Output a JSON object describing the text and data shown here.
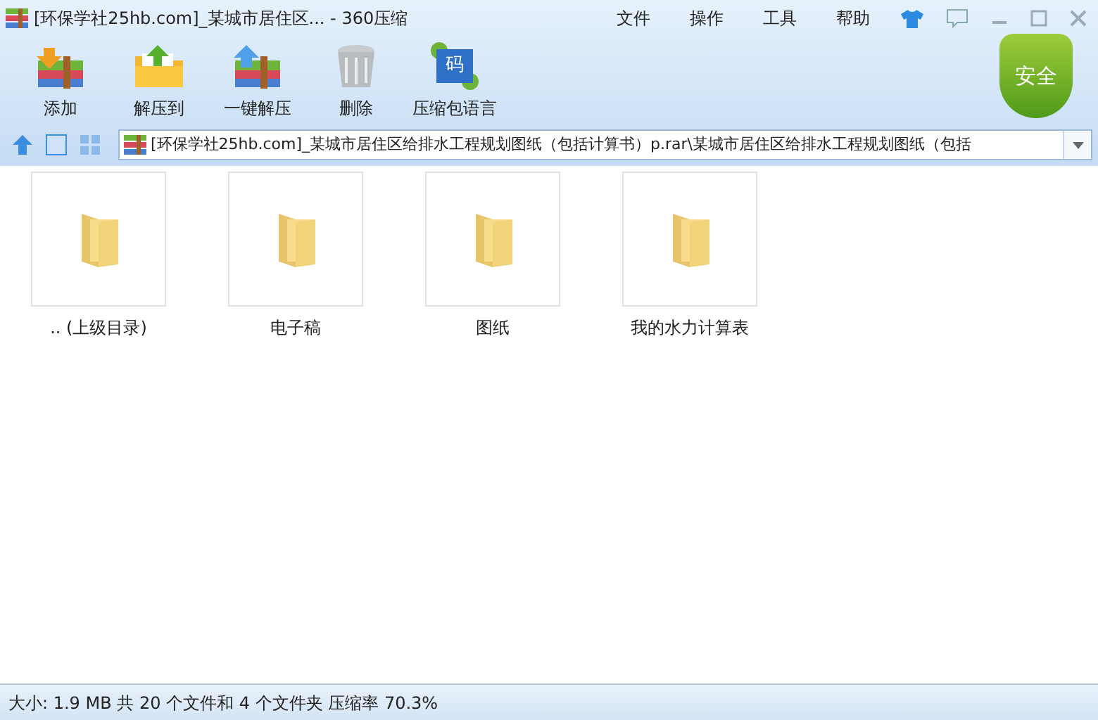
{
  "window": {
    "title": "[环保学社25hb.com]_某城市居住区... - 360压缩"
  },
  "menu": [
    "文件",
    "操作",
    "工具",
    "帮助"
  ],
  "toolbar": [
    {
      "kind": "add",
      "label": "添加"
    },
    {
      "kind": "extract",
      "label": "解压到"
    },
    {
      "kind": "oneclick",
      "label": "一键解压"
    },
    {
      "kind": "delete",
      "label": "删除"
    },
    {
      "kind": "language",
      "label": "压缩包语言",
      "glyph": "码"
    }
  ],
  "security_badge": "安全",
  "address": "[环保学社25hb.com]_某城市居住区给排水工程规划图纸（包括计算书）p.rar\\某城市居住区给排水工程规划图纸（包括",
  "items": [
    {
      "label": ".. (上级目录)"
    },
    {
      "label": "电子稿"
    },
    {
      "label": "图纸"
    },
    {
      "label": "我的水力计算表"
    }
  ],
  "status_bar": "大小: 1.9 MB 共 20 个文件和 4 个文件夹 压缩率 70.3%"
}
